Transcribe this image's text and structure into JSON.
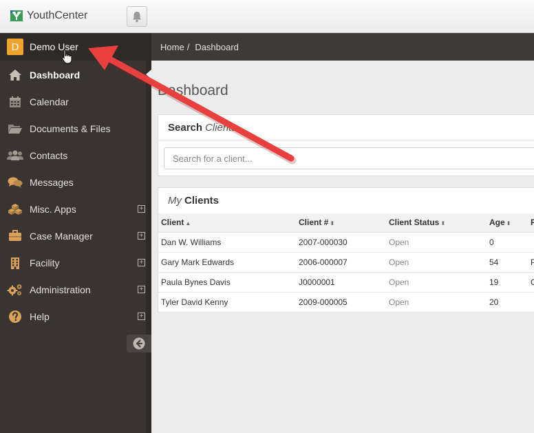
{
  "app": {
    "name": "YouthCenter"
  },
  "user": {
    "initial": "D",
    "name": "Demo User"
  },
  "breadcrumb": {
    "home": "Home",
    "separator": "/",
    "current": "Dashboard"
  },
  "sidebar": {
    "items": [
      {
        "label": "Dashboard",
        "icon": "home-icon",
        "active": true,
        "expandable": false
      },
      {
        "label": "Calendar",
        "icon": "calendar-icon",
        "expandable": false
      },
      {
        "label": "Documents & Files",
        "icon": "folder-open-icon",
        "expandable": false
      },
      {
        "label": "Contacts",
        "icon": "users-icon",
        "expandable": false
      },
      {
        "label": "Messages",
        "icon": "comments-icon",
        "expandable": false
      },
      {
        "label": "Misc. Apps",
        "icon": "cubes-icon",
        "expandable": true
      },
      {
        "label": "Case Manager",
        "icon": "briefcase-icon",
        "expandable": true
      },
      {
        "label": "Facility",
        "icon": "building-icon",
        "expandable": true
      },
      {
        "label": "Administration",
        "icon": "gears-icon",
        "expandable": true
      },
      {
        "label": "Help",
        "icon": "question-circle-icon",
        "expandable": true
      }
    ],
    "expand_symbol": "+"
  },
  "page": {
    "title": "Dashboard"
  },
  "search": {
    "title_italic": "Search",
    "title_bold": "Clients",
    "placeholder": "Search for a client..."
  },
  "clients": {
    "title_italic": "My",
    "title_bold": "Clients",
    "columns": [
      "Client",
      "Client #",
      "Client Status",
      "Age",
      "P"
    ],
    "rows": [
      {
        "name": "Dan W. Williams",
        "number": "2007-000030",
        "status": "Open",
        "age": "0",
        "extra": ""
      },
      {
        "name": "Gary Mark Edwards",
        "number": "2006-000007",
        "status": "Open",
        "age": "54",
        "extra": "P"
      },
      {
        "name": "Paula Bynes Davis",
        "number": "J0000001",
        "status": "Open",
        "age": "19",
        "extra": "C"
      },
      {
        "name": "Tyler David Kenny",
        "number": "2009-000005",
        "status": "Open",
        "age": "20",
        "extra": ""
      }
    ]
  },
  "colors": {
    "accent": "#f0a22e",
    "sidebar": "#393431",
    "arrow": "#e8403f",
    "status": "#888888"
  }
}
